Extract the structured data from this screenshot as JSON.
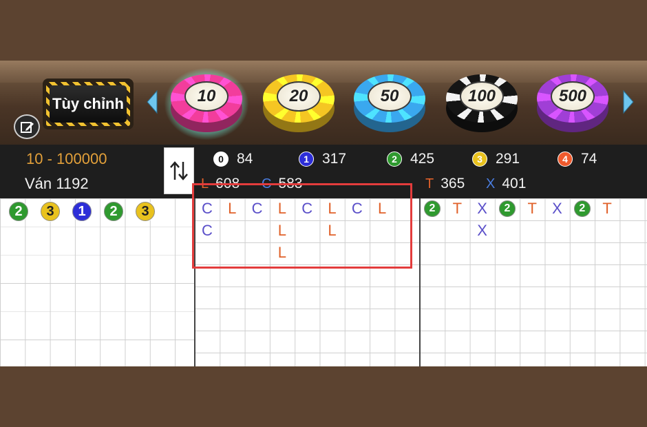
{
  "chip_bar": {
    "custom_label": "Tùy chỉnh",
    "chips": [
      {
        "value": "10",
        "color": "#f23d9c",
        "selected": true
      },
      {
        "value": "20",
        "color": "#f5c623",
        "selected": false
      },
      {
        "value": "50",
        "color": "#3aa8ef",
        "selected": false
      },
      {
        "value": "100",
        "color": "#151515",
        "selected": false
      },
      {
        "value": "500",
        "color": "#a03fd6",
        "selected": false
      }
    ]
  },
  "info": {
    "bet_range": "10 - 100000",
    "round": "Ván 1192",
    "stats_row1": [
      {
        "ball": "0",
        "ball_color": "#ffffff",
        "count": "84"
      },
      {
        "ball": "1",
        "ball_color": "#2d2ed8",
        "count": "317"
      },
      {
        "ball": "2",
        "ball_color": "#2f9a2f",
        "count": "425"
      },
      {
        "ball": "3",
        "ball_color": "#e9c21e",
        "count": "291"
      },
      {
        "ball": "4",
        "ball_color": "#ef5a2d",
        "count": "74"
      }
    ],
    "stats_row2": [
      {
        "label": "L",
        "label_color": "#e0612a",
        "count": "608"
      },
      {
        "label": "C",
        "label_color": "#4a7de0",
        "count": "583"
      },
      {
        "label": "T",
        "label_color": "#e0612a",
        "count": "365"
      },
      {
        "label": "X",
        "label_color": "#4a7de0",
        "count": "401"
      }
    ]
  },
  "roads": {
    "left_balls": [
      {
        "n": "2",
        "color": "#2f9a2f"
      },
      {
        "n": "3",
        "color": "#e9c21e"
      },
      {
        "n": "1",
        "color": "#2d2ed8"
      },
      {
        "n": "2",
        "color": "#2f9a2f"
      },
      {
        "n": "3",
        "color": "#e9c21e"
      }
    ],
    "mid_columns": [
      [
        "C",
        "C"
      ],
      [
        "L"
      ],
      [
        "C"
      ],
      [
        "L",
        "L",
        "L"
      ],
      [
        "C"
      ],
      [
        "L",
        "L"
      ],
      [
        "C"
      ],
      [
        "L"
      ]
    ],
    "right_columns": [
      [
        "2"
      ],
      [
        "T"
      ],
      [
        "X",
        "X"
      ],
      [
        "2"
      ],
      [
        "T"
      ],
      [
        "X"
      ],
      [
        "2"
      ],
      [
        "T"
      ]
    ]
  },
  "colors": {
    "letter_L": "#e0612a",
    "letter_C": "#5a4fc9",
    "letter_T": "#e0612a",
    "letter_X": "#5a4fc9",
    "ball_2": "#2f9a2f",
    "highlight": "#e33c3c"
  }
}
